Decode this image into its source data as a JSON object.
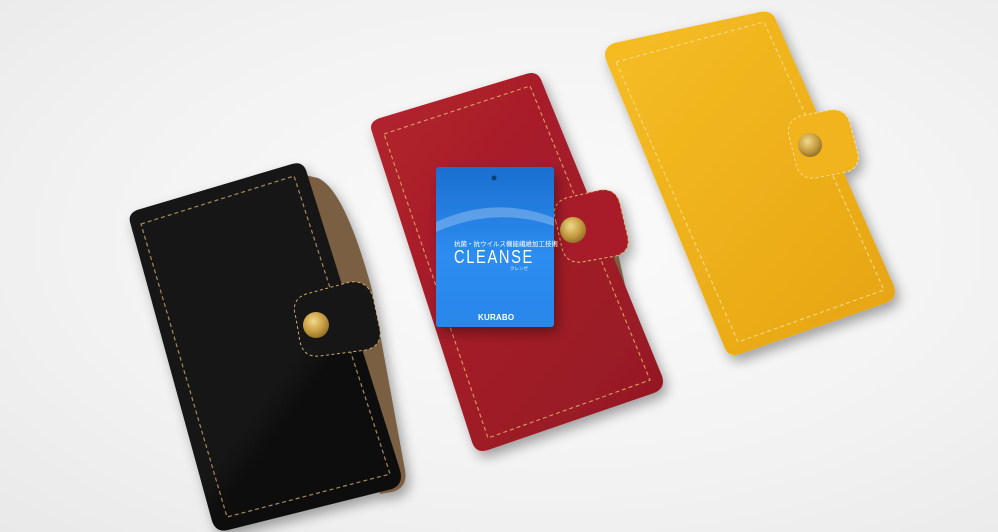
{
  "photo": {
    "cases": [
      {
        "name": "black-case",
        "color": "#111111",
        "stitch": "#c9a86a"
      },
      {
        "name": "red-case",
        "color": "#a81f2a",
        "stitch": "#e4b36a"
      },
      {
        "name": "yellow-case",
        "color": "#f0b21c",
        "stitch": "#f6d27a"
      }
    ],
    "snap_color": "#c9a347",
    "tag": {
      "title_jp": "抗菌・抗ウイルス機能繊維加工技術",
      "brand": "CLEANSE",
      "kana": "クレンゼ",
      "maker": "KURABO",
      "color_top": "#1a78d8",
      "color_bottom": "#2f8ff0"
    }
  }
}
